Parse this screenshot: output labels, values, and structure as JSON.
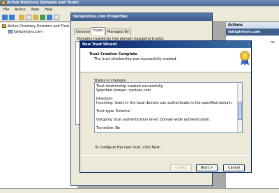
{
  "app": {
    "title": "Active Directory Domains and Trusts",
    "menu": [
      "File",
      "Action",
      "View",
      "Help"
    ]
  },
  "tree": {
    "root": "Active Directory Domains and Trust",
    "child": "tailspintoys.com"
  },
  "actions": {
    "header": "Actions",
    "domain": "tailspintoys.com",
    "more": "ns"
  },
  "props": {
    "title": "tailspintoys.com Properties",
    "tabs": [
      "General",
      "Trusts",
      "Managed By"
    ],
    "list_label": "Domains trusted by this domain (outgoing trusts):"
  },
  "wizard": {
    "title": "New Trust Wizard",
    "heading": "Trust Creation Complete",
    "subheading": "The trust relationship was successfully created.",
    "status_label": "Status of changes:",
    "status_lines": [
      "Trust relationship created successfully.",
      "Specified domain: contoso.com",
      "",
      "Direction:",
      "Incoming: Users in the local domain can authenticate in the specified domain.",
      "",
      "Trust type: External",
      "",
      "Outgoing trust authentication level: Domain-wide authentication.",
      "",
      "Transitive: No"
    ],
    "configure_text": "To configure the new trust, click Next.",
    "back_label": "< Back",
    "next_label": "Next >",
    "cancel_label": "Cancel"
  },
  "colors": {
    "accent": "#3e5f8c",
    "wizard_title": "#0a246a"
  }
}
